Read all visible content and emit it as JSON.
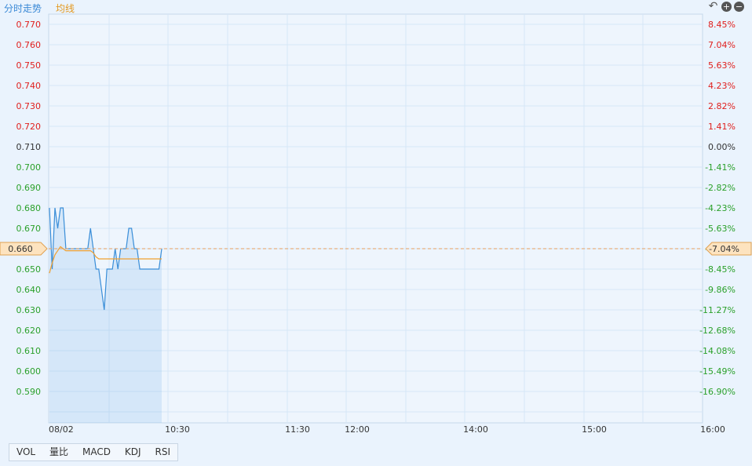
{
  "header": {
    "tab_intraday": "分时走势",
    "tab_avg_line": "均线",
    "controls": [
      "undo-icon",
      "plus-circle-icon",
      "minus-circle-icon"
    ]
  },
  "indicators": [
    "VOL",
    "量比",
    "MACD",
    "KDJ",
    "RSI"
  ],
  "colors": {
    "price_line": "#3a8ed8",
    "avg_line": "#f0a030",
    "up": "#e0201e",
    "down": "#2aa02a",
    "flat": "#333333",
    "grid": "#d6e6f6"
  },
  "chart_data": {
    "type": "line",
    "date_label": "08/02",
    "x_ticks": [
      "10:30",
      "11:30",
      "12:00",
      "14:00",
      "15:00",
      "16:00"
    ],
    "y_ticks_left": [
      "0.770",
      "0.760",
      "0.750",
      "0.740",
      "0.730",
      "0.720",
      "0.710",
      "0.700",
      "0.690",
      "0.680",
      "0.670",
      "0.660",
      "0.650",
      "0.640",
      "0.630",
      "0.620",
      "0.610",
      "0.600",
      "0.590"
    ],
    "y_ticks_right": [
      "8.45%",
      "7.04%",
      "5.63%",
      "4.23%",
      "2.82%",
      "1.41%",
      "0.00%",
      "-1.41%",
      "-2.82%",
      "-4.23%",
      "-5.63%",
      "-7.04%",
      "-8.45%",
      "-9.86%",
      "-11.27%",
      "-12.68%",
      "-14.08%",
      "-15.49%",
      "-16.90%"
    ],
    "ylim": [
      0.585,
      0.775
    ],
    "prev_close": 0.71,
    "current_price_label": "0.660",
    "current_pct_label": "-7.04%",
    "price_series": [
      0.68,
      0.65,
      0.68,
      0.67,
      0.68,
      0.68,
      0.66,
      0.66,
      0.66,
      0.66,
      0.66,
      0.66,
      0.66,
      0.66,
      0.66,
      0.67,
      0.66,
      0.65,
      0.65,
      0.64,
      0.63,
      0.65,
      0.65,
      0.65,
      0.66,
      0.65,
      0.66,
      0.66,
      0.66,
      0.67,
      0.67,
      0.66,
      0.66,
      0.65,
      0.65,
      0.65,
      0.65,
      0.65,
      0.65,
      0.65,
      0.65,
      0.66
    ],
    "avg_series": [
      0.648,
      0.653,
      0.657,
      0.659,
      0.661,
      0.66,
      0.659,
      0.659,
      0.659,
      0.659,
      0.659,
      0.659,
      0.659,
      0.659,
      0.659,
      0.659,
      0.658,
      0.656,
      0.655,
      0.655,
      0.655,
      0.655,
      0.655,
      0.655,
      0.655,
      0.655,
      0.655,
      0.655,
      0.655,
      0.655,
      0.655,
      0.655,
      0.655,
      0.655,
      0.655,
      0.655,
      0.655,
      0.655,
      0.655,
      0.655,
      0.655,
      0.655
    ]
  }
}
